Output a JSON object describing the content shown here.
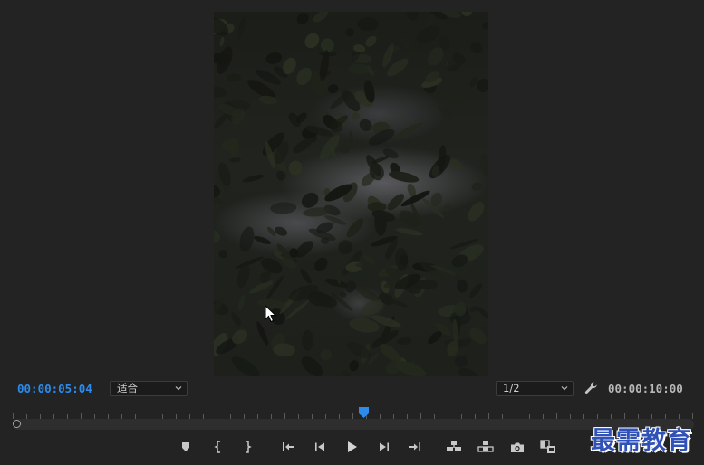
{
  "monitor": {
    "current_timecode": "00:00:05:04",
    "total_timecode": "00:00:10:00",
    "zoom_value": "适合",
    "resolution_value": "1/2",
    "accent_color": "#2d8ceb"
  },
  "transport": {
    "buttons": [
      {
        "name": "add-marker-button",
        "icon": "marker-icon"
      },
      {
        "name": "mark-in-button",
        "icon": "mark-in-icon"
      },
      {
        "name": "mark-out-button",
        "icon": "mark-out-icon"
      },
      {
        "name": "go-to-in-button",
        "icon": "go-to-in-icon"
      },
      {
        "name": "step-back-button",
        "icon": "step-back-icon"
      },
      {
        "name": "play-button",
        "icon": "play-icon"
      },
      {
        "name": "step-forward-button",
        "icon": "step-forward-icon"
      },
      {
        "name": "go-to-out-button",
        "icon": "go-to-out-icon"
      },
      {
        "name": "insert-button",
        "icon": "insert-icon"
      },
      {
        "name": "overwrite-button",
        "icon": "overwrite-icon"
      },
      {
        "name": "export-frame-button",
        "icon": "camera-icon"
      },
      {
        "name": "comparison-view-button",
        "icon": "comparison-icon"
      }
    ]
  },
  "playback": {
    "playhead_position_fraction": 0.5173
  },
  "watermark": {
    "text": "最需教育"
  }
}
